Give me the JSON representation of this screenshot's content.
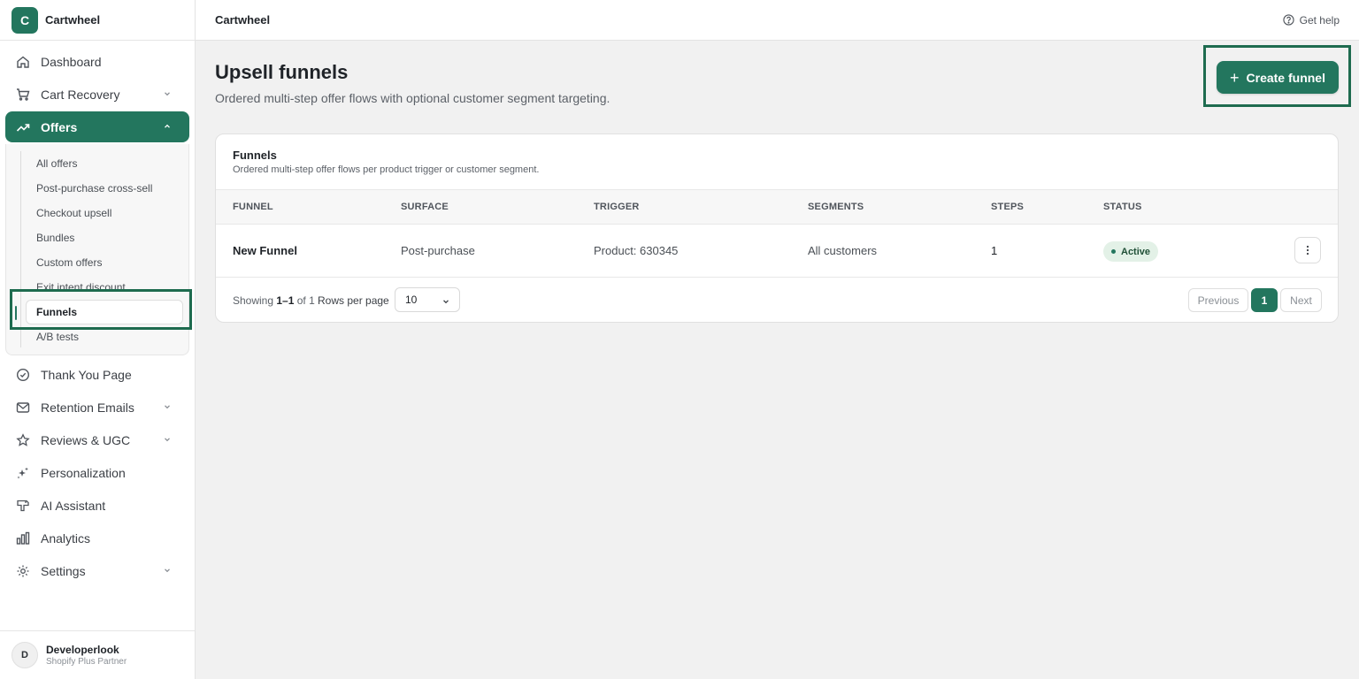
{
  "brand": {
    "logo_letter": "C",
    "name": "Cartwheel"
  },
  "sidebar": {
    "items": [
      {
        "label": "Dashboard",
        "icon": "home-icon"
      },
      {
        "label": "Cart Recovery",
        "icon": "cart-icon",
        "expandable": true
      },
      {
        "label": "Offers",
        "icon": "trending-up-icon",
        "expandable": true,
        "active": true
      },
      {
        "label": "Thank You Page",
        "icon": "check-circle-icon"
      },
      {
        "label": "Retention Emails",
        "icon": "mail-icon",
        "expandable": true
      },
      {
        "label": "Reviews & UGC",
        "icon": "star-icon",
        "expandable": true
      },
      {
        "label": "Personalization",
        "icon": "sparkle-icon"
      },
      {
        "label": "AI Assistant",
        "icon": "ai-icon"
      },
      {
        "label": "Analytics",
        "icon": "bar-chart-icon"
      },
      {
        "label": "Settings",
        "icon": "gear-icon",
        "expandable": true
      }
    ],
    "offers_sub": [
      "All offers",
      "Post-purchase cross-sell",
      "Checkout upsell",
      "Bundles",
      "Custom offers",
      "Exit intent discount",
      "Funnels",
      "A/B tests"
    ],
    "selected_sub": "Funnels"
  },
  "profile": {
    "initial": "D",
    "name": "Developerlook",
    "role": "Shopify Plus Partner"
  },
  "topbar": {
    "title": "Cartwheel",
    "help_label": "Get help"
  },
  "page": {
    "title": "Upsell funnels",
    "subtitle": "Ordered multi-step offer flows with optional customer segment targeting.",
    "create_label": "Create funnel"
  },
  "card": {
    "title": "Funnels",
    "subtitle": "Ordered multi-step offer flows per product trigger or customer segment."
  },
  "table": {
    "headers": [
      "FUNNEL",
      "SURFACE",
      "TRIGGER",
      "SEGMENTS",
      "STEPS",
      "STATUS"
    ],
    "rows": [
      {
        "funnel": "New Funnel",
        "surface": "Post-purchase",
        "trigger": "Product: 630345",
        "segments": "All customers",
        "steps": "1",
        "status": "Active"
      }
    ]
  },
  "footer": {
    "showing_prefix": "Showing",
    "showing_range": "1–1",
    "showing_suffix": "of 1",
    "rows_per_page_label": "Rows per page",
    "rows_per_page_value": "10",
    "prev_label": "Previous",
    "current_page": "1",
    "next_label": "Next"
  },
  "colors": {
    "accent": "#23765e",
    "focus_outline": "#1e6b4f",
    "badge_bg": "#e3f1e7"
  }
}
